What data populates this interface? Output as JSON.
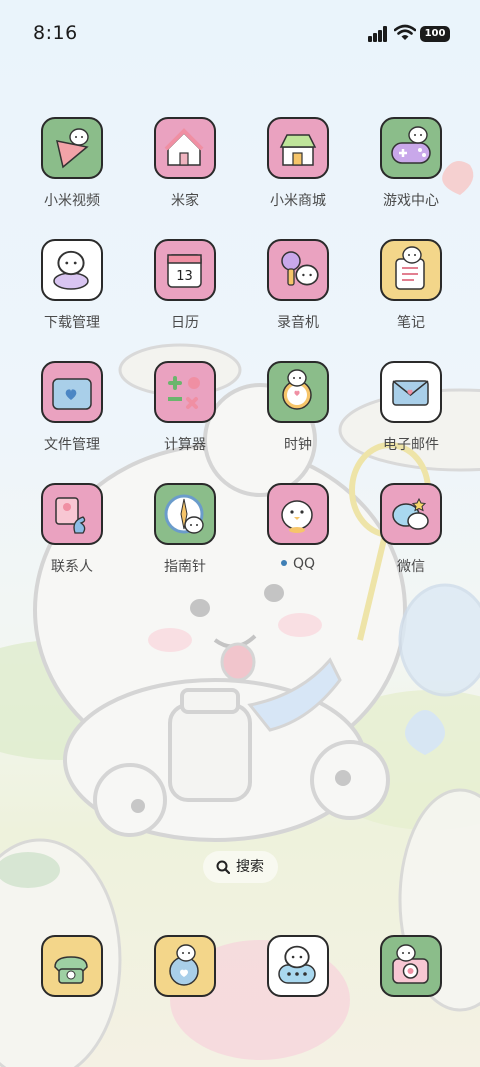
{
  "status_bar": {
    "time": "8:16",
    "battery": "100"
  },
  "apps": [
    {
      "label": "小米视频",
      "icon": "video-icon",
      "bg": "#8bbd8a"
    },
    {
      "label": "米家",
      "icon": "home-icon",
      "bg": "#eaa2c0"
    },
    {
      "label": "小米商城",
      "icon": "store-icon",
      "bg": "#eaa2c0"
    },
    {
      "label": "游戏中心",
      "icon": "gamepad-icon",
      "bg": "#8bbd8a"
    },
    {
      "label": "下载管理",
      "icon": "download-icon",
      "bg": "#ffffff"
    },
    {
      "label": "日历",
      "icon": "calendar-icon",
      "bg": "#eaa2c0",
      "calendar_day": "13"
    },
    {
      "label": "录音机",
      "icon": "microphone-icon",
      "bg": "#eaa2c0"
    },
    {
      "label": "笔记",
      "icon": "notes-icon",
      "bg": "#f3d68a"
    },
    {
      "label": "文件管理",
      "icon": "folder-icon",
      "bg": "#eaa2c0"
    },
    {
      "label": "计算器",
      "icon": "calculator-icon",
      "bg": "#eaa2c0"
    },
    {
      "label": "时钟",
      "icon": "clock-icon",
      "bg": "#8bbd8a"
    },
    {
      "label": "电子邮件",
      "icon": "mail-icon",
      "bg": "#ffffff"
    },
    {
      "label": "联系人",
      "icon": "contacts-icon",
      "bg": "#eaa2c0"
    },
    {
      "label": "指南针",
      "icon": "compass-icon",
      "bg": "#8bbd8a"
    },
    {
      "label": "QQ",
      "icon": "qq-icon",
      "bg": "#eaa2c0",
      "notification_dot": true
    },
    {
      "label": "微信",
      "icon": "wechat-icon",
      "bg": "#eaa2c0"
    }
  ],
  "search": {
    "label": "搜索"
  },
  "dock": [
    {
      "icon": "phone-icon",
      "bg": "#f3d68a"
    },
    {
      "icon": "browser-icon",
      "bg": "#f3d68a"
    },
    {
      "icon": "messages-icon",
      "bg": "#ffffff"
    },
    {
      "icon": "camera-icon",
      "bg": "#8bbd8a"
    }
  ]
}
